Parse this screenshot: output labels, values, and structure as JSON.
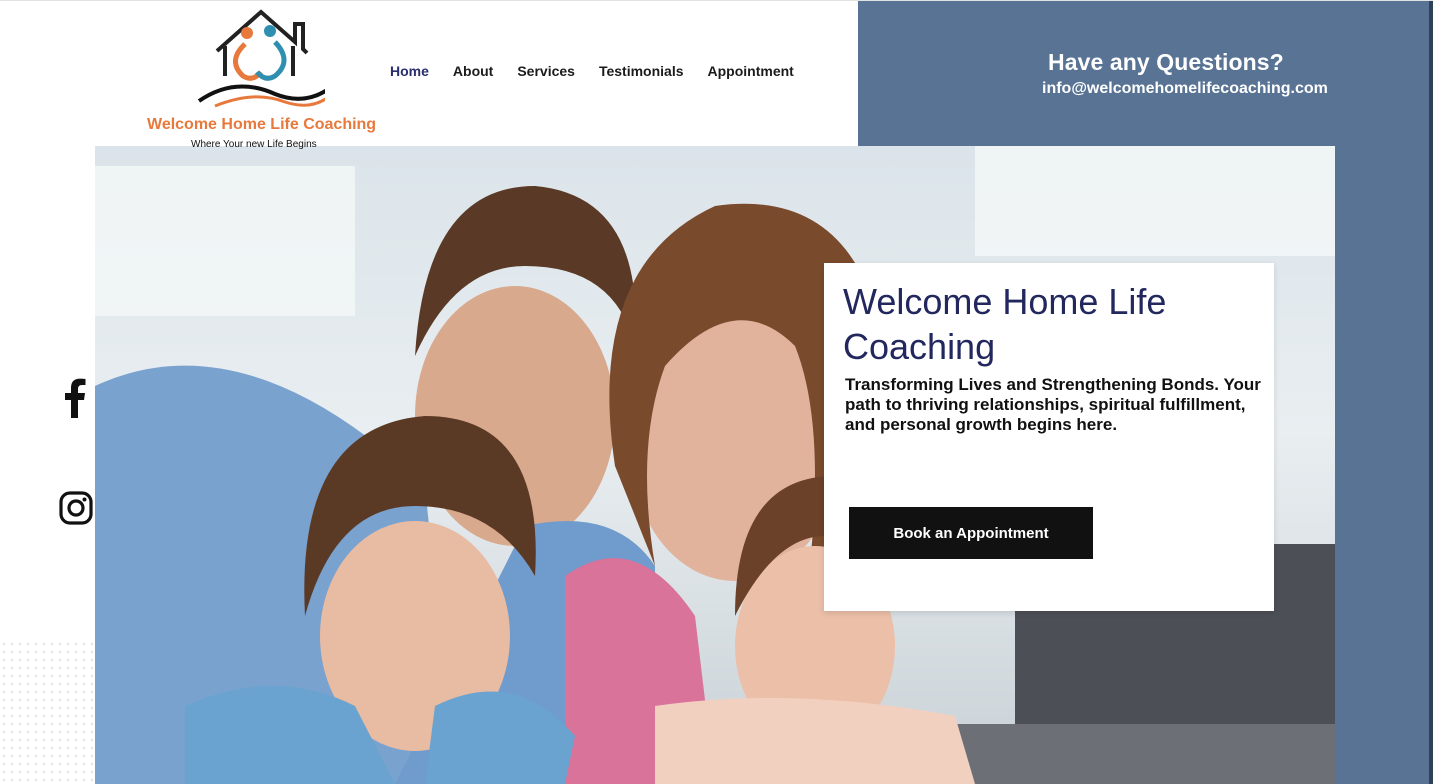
{
  "brand": {
    "name": "Welcome Home Life Coaching",
    "tagline": "Where Your new Life Begins"
  },
  "nav": {
    "items": [
      "Home",
      "About",
      "Services",
      "Testimonials",
      "Appointment"
    ],
    "active": "Home"
  },
  "contact": {
    "title": "Have any Questions?",
    "email": "info@welcomehomelifecoaching.com"
  },
  "hero": {
    "title": "Welcome Home Life Coaching",
    "text": "Transforming Lives and Strengthening Bonds. Your path to thriving relationships, spiritual fulfillment, and personal growth begins here.",
    "button": "Book an Appointment",
    "photo_icon": "family-photo"
  },
  "social": {
    "facebook_icon": "facebook-icon",
    "instagram_icon": "instagram-icon"
  },
  "colors": {
    "accent_orange": "#e8793d",
    "panel_blue": "#587394",
    "title_navy": "#22275e",
    "button_black": "#111111"
  }
}
